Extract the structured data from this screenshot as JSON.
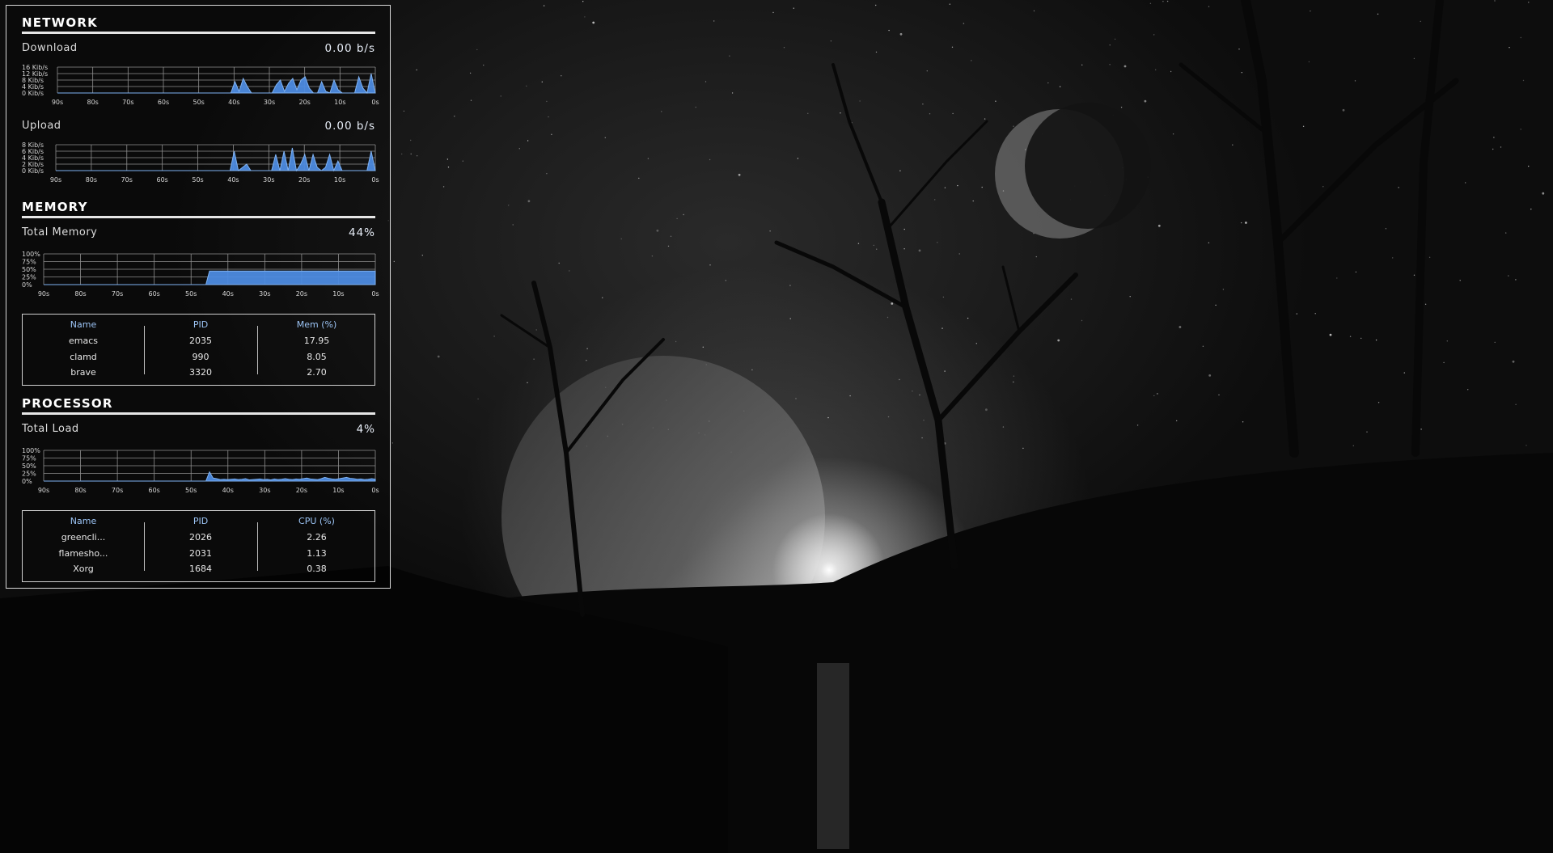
{
  "network": {
    "title": "NETWORK",
    "download": {
      "label": "Download",
      "value": "0.00 b/s",
      "ylabels": [
        "16 Kib/s",
        "12 Kib/s",
        "8 Kib/s",
        "4 Kib/s",
        "0 Kib/s"
      ],
      "series": [
        0,
        0,
        0,
        0,
        0,
        0,
        0,
        0,
        0,
        0,
        0,
        0,
        0,
        0,
        0,
        0,
        0,
        0,
        0,
        0,
        0,
        0,
        0,
        0,
        0,
        0,
        0,
        0,
        0,
        0,
        0,
        0,
        0,
        0,
        0,
        0,
        0,
        0,
        0,
        0,
        0,
        0,
        0,
        7,
        1,
        9,
        4,
        0,
        0,
        0,
        0,
        0,
        0,
        5,
        8,
        1,
        6,
        9,
        2,
        8,
        10,
        3,
        0,
        0,
        7,
        1,
        0,
        8,
        2,
        0,
        0,
        0,
        0,
        10,
        3,
        0,
        12,
        0
      ],
      "ymax": 16
    },
    "upload": {
      "label": "Upload",
      "value": "0.00 b/s",
      "ylabels": [
        "8 Kib/s",
        "6 Kib/s",
        "4 Kib/s",
        "2 Kib/s",
        "0 Kib/s"
      ],
      "series": [
        0,
        0,
        0,
        0,
        0,
        0,
        0,
        0,
        0,
        0,
        0,
        0,
        0,
        0,
        0,
        0,
        0,
        0,
        0,
        0,
        0,
        0,
        0,
        0,
        0,
        0,
        0,
        0,
        0,
        0,
        0,
        0,
        0,
        0,
        0,
        0,
        0,
        0,
        0,
        0,
        0,
        0,
        0,
        6,
        0,
        1,
        2,
        0,
        0,
        0,
        0,
        0,
        0,
        5,
        0,
        6,
        0,
        7,
        0,
        2,
        5,
        0,
        5,
        1,
        0,
        1,
        5,
        0,
        3,
        0,
        0,
        0,
        0,
        0,
        0,
        0,
        6,
        0
      ],
      "ymax": 8
    }
  },
  "memory": {
    "title": "MEMORY",
    "label": "Total Memory",
    "value": "44%",
    "ylabels": [
      "100%",
      "75%",
      "50%",
      "25%",
      "0%"
    ],
    "series": [
      0,
      0,
      0,
      0,
      0,
      0,
      0,
      0,
      0,
      0,
      0,
      0,
      0,
      0,
      0,
      0,
      0,
      0,
      0,
      0,
      0,
      0,
      0,
      0,
      0,
      0,
      0,
      0,
      0,
      0,
      0,
      0,
      0,
      0,
      0,
      0,
      0,
      0,
      0,
      0,
      0,
      0,
      0,
      0,
      0,
      0,
      44,
      44,
      44,
      44,
      44,
      44,
      44,
      44,
      44,
      44,
      44,
      44,
      44,
      44,
      44,
      44,
      44,
      44,
      44,
      44,
      44,
      44,
      44,
      44,
      44,
      44,
      44,
      44,
      44,
      44,
      44,
      44,
      44,
      44,
      44,
      44,
      44,
      44,
      44,
      44,
      44,
      44,
      44,
      44,
      44,
      44,
      44
    ],
    "ymax": 100,
    "table": {
      "headers": [
        "Name",
        "PID",
        "Mem (%)"
      ],
      "rows": [
        [
          "emacs",
          "2035",
          "17.95"
        ],
        [
          "clamd",
          "990",
          "8.05"
        ],
        [
          "brave",
          "3320",
          "2.70"
        ]
      ]
    }
  },
  "processor": {
    "title": "PROCESSOR",
    "label": "Total Load",
    "value": "4%",
    "ylabels": [
      "100%",
      "75%",
      "50%",
      "25%",
      "0%"
    ],
    "series": [
      0,
      0,
      0,
      0,
      0,
      0,
      0,
      0,
      0,
      0,
      0,
      0,
      0,
      0,
      0,
      0,
      0,
      0,
      0,
      0,
      0,
      0,
      0,
      0,
      0,
      0,
      0,
      0,
      0,
      0,
      0,
      0,
      0,
      0,
      0,
      0,
      0,
      0,
      0,
      0,
      0,
      0,
      0,
      0,
      0,
      0,
      30,
      10,
      8,
      5,
      6,
      5,
      6,
      7,
      5,
      6,
      8,
      4,
      5,
      6,
      7,
      5,
      6,
      4,
      7,
      5,
      6,
      8,
      6,
      5,
      7,
      6,
      8,
      10,
      7,
      6,
      5,
      8,
      12,
      9,
      7,
      6,
      8,
      10,
      12,
      9,
      8,
      6,
      7,
      5,
      6,
      8,
      6
    ],
    "ymax": 100,
    "table": {
      "headers": [
        "Name",
        "PID",
        "CPU (%)"
      ],
      "rows": [
        [
          "greencli...",
          "2026",
          "2.26"
        ],
        [
          "flamesho...",
          "2031",
          "1.13"
        ],
        [
          "Xorg",
          "1684",
          "0.38"
        ]
      ]
    }
  },
  "xlabels": [
    "90s",
    "80s",
    "70s",
    "60s",
    "50s",
    "40s",
    "30s",
    "20s",
    "10s",
    "0s"
  ],
  "colors": {
    "fill": "#4d8be0",
    "fill_light": "#7fb2f2",
    "grid": "#8f8f8f",
    "accent_text": "#9cc4f5"
  }
}
